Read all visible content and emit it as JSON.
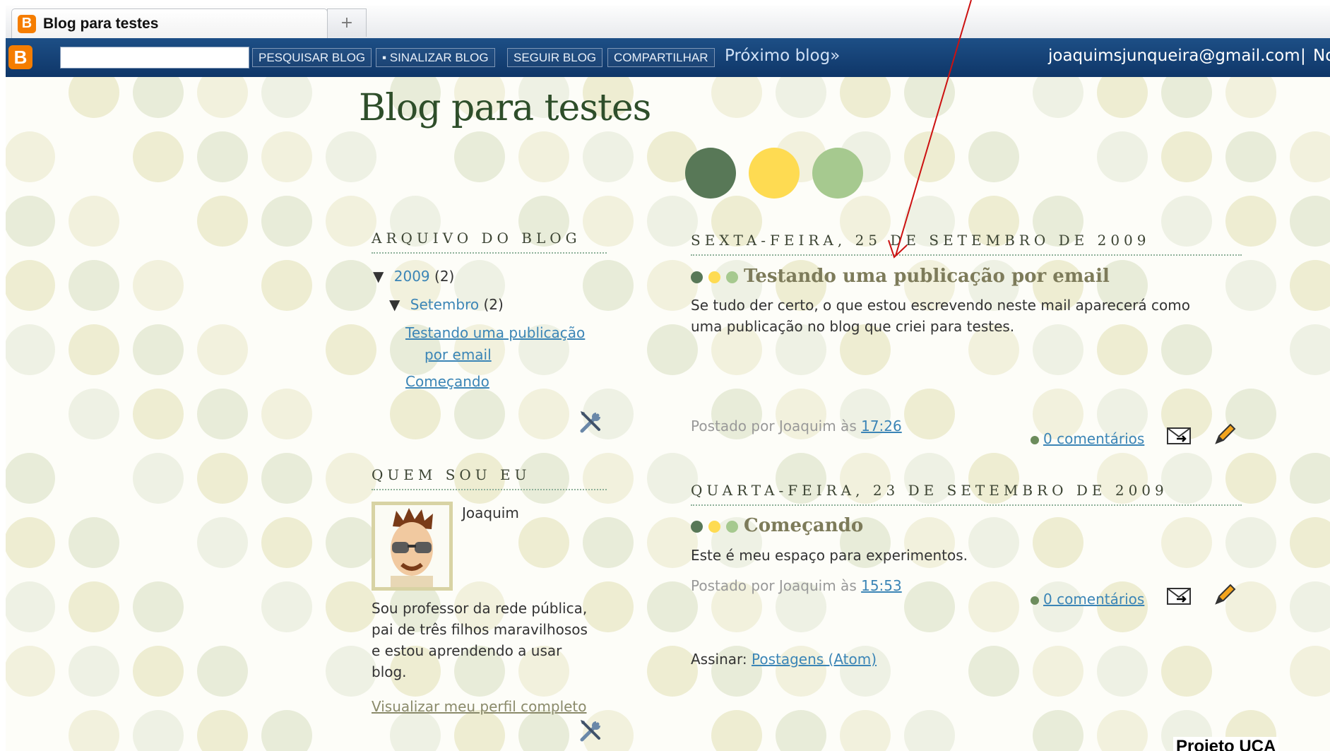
{
  "browser": {
    "tab_title": "Blog para testes",
    "tab_icon": "blogger-icon",
    "new_tab_symbol": "+"
  },
  "navbar": {
    "logo": "B",
    "search_value": "",
    "buttons": [
      "PESQUISAR BLOG",
      "▪ SINALIZAR BLOG",
      "SEGUIR BLOG",
      "COMPARTILHAR"
    ],
    "next_blog": "Próximo blog»",
    "email": "joaquimsjunqueira@gmail.com",
    "separator": "|",
    "more": "No"
  },
  "blog": {
    "title": "Blog para testes"
  },
  "sidebar": {
    "archive": {
      "heading": "ARQUIVO DO BLOG",
      "year_toggle": "▼",
      "year_label": "2009",
      "year_count": "(2)",
      "month_toggle": "▼",
      "month_label": "Setembro",
      "month_count": "(2)",
      "posts": [
        "Testando uma publicação",
        "por email",
        "Começando"
      ]
    },
    "about": {
      "heading": "QUEM SOU EU",
      "name": "Joaquim",
      "bio": [
        "Sou professor da rede pública,",
        "pai de três filhos maravilhosos",
        "e estou aprendendo a usar",
        "blog."
      ],
      "profile_link": "Visualizar meu perfil completo"
    }
  },
  "posts": [
    {
      "date": "SEXTA-FEIRA, 25 DE SETEMBRO DE 2009",
      "title": "Testando uma publicação por email",
      "body": [
        "Se tudo der certo, o que estou escrevendo neste mail aparecerá como",
        "uma publicação no blog que criei para testes."
      ],
      "posted_by": "Postado por Joaquim às",
      "time": "17:26",
      "comments": "0 comentários"
    },
    {
      "date": "QUARTA-FEIRA, 23 DE SETEMBRO DE 2009",
      "title": "Começando",
      "body": [
        "Este é meu espaço para experimentos."
      ],
      "posted_by": "Postado por Joaquim às",
      "time": "15:53",
      "comments": "0 comentários"
    }
  ],
  "subscribe": {
    "label": "Assinar:",
    "link": "Postagens (Atom)"
  },
  "footer": {
    "text": "Projeto UCA"
  },
  "colors": {
    "dark_green": "#587857",
    "yellow": "#fedb52",
    "light_green": "#a6c98f",
    "navbar_blue": "#173f74",
    "annotation_red": "#cc1111"
  }
}
